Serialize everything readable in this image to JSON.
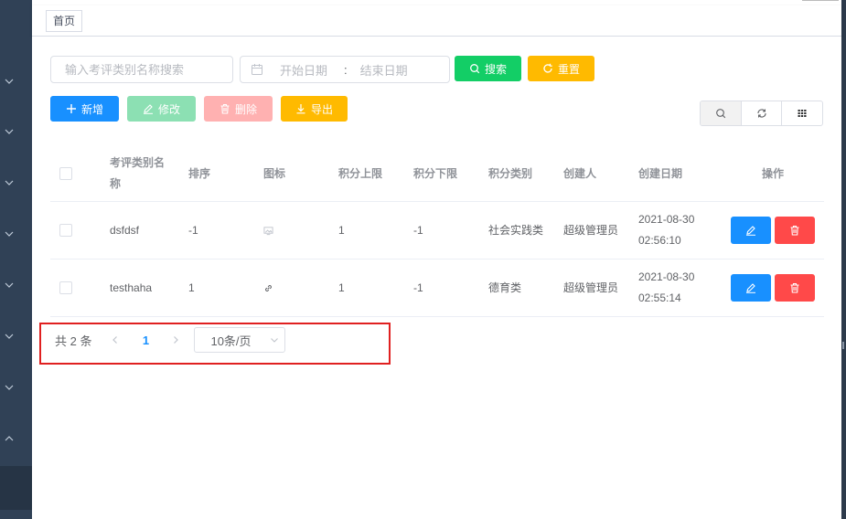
{
  "tags": {
    "home": "首页"
  },
  "search": {
    "name_placeholder": "输入考评类别名称搜索",
    "start_date_placeholder": "开始日期",
    "range_separator": ":",
    "end_date_placeholder": "结束日期",
    "search_label": "搜索",
    "reset_label": "重置"
  },
  "toolbar": {
    "add_label": "新增",
    "edit_label": "修改",
    "delete_label": "删除",
    "export_label": "导出"
  },
  "table": {
    "columns": [
      "考评类别名称",
      "排序",
      "图标",
      "积分上限",
      "积分下限",
      "积分类别",
      "创建人",
      "创建日期",
      "操作"
    ],
    "rows": [
      {
        "name": "dsfdsf",
        "sort": "-1",
        "icon": "image-icon",
        "max": "1",
        "min": "-1",
        "type": "社会实践类",
        "creator": "超级管理员",
        "date": "2021-08-30",
        "time": "02:56:10"
      },
      {
        "name": "testhaha",
        "sort": "1",
        "icon": "link-icon",
        "max": "1",
        "min": "-1",
        "type": "德育类",
        "creator": "超级管理员",
        "date": "2021-08-30",
        "time": "02:55:14"
      }
    ]
  },
  "pagination": {
    "total_text": "共 2 条",
    "current_page": "1",
    "page_size": "10条/页"
  },
  "colors": {
    "primary": "#1890ff",
    "success": "#13ce66",
    "warning": "#ffba00",
    "danger": "#ff4949",
    "sidebar": "#304156",
    "highlight": "#e02020"
  }
}
